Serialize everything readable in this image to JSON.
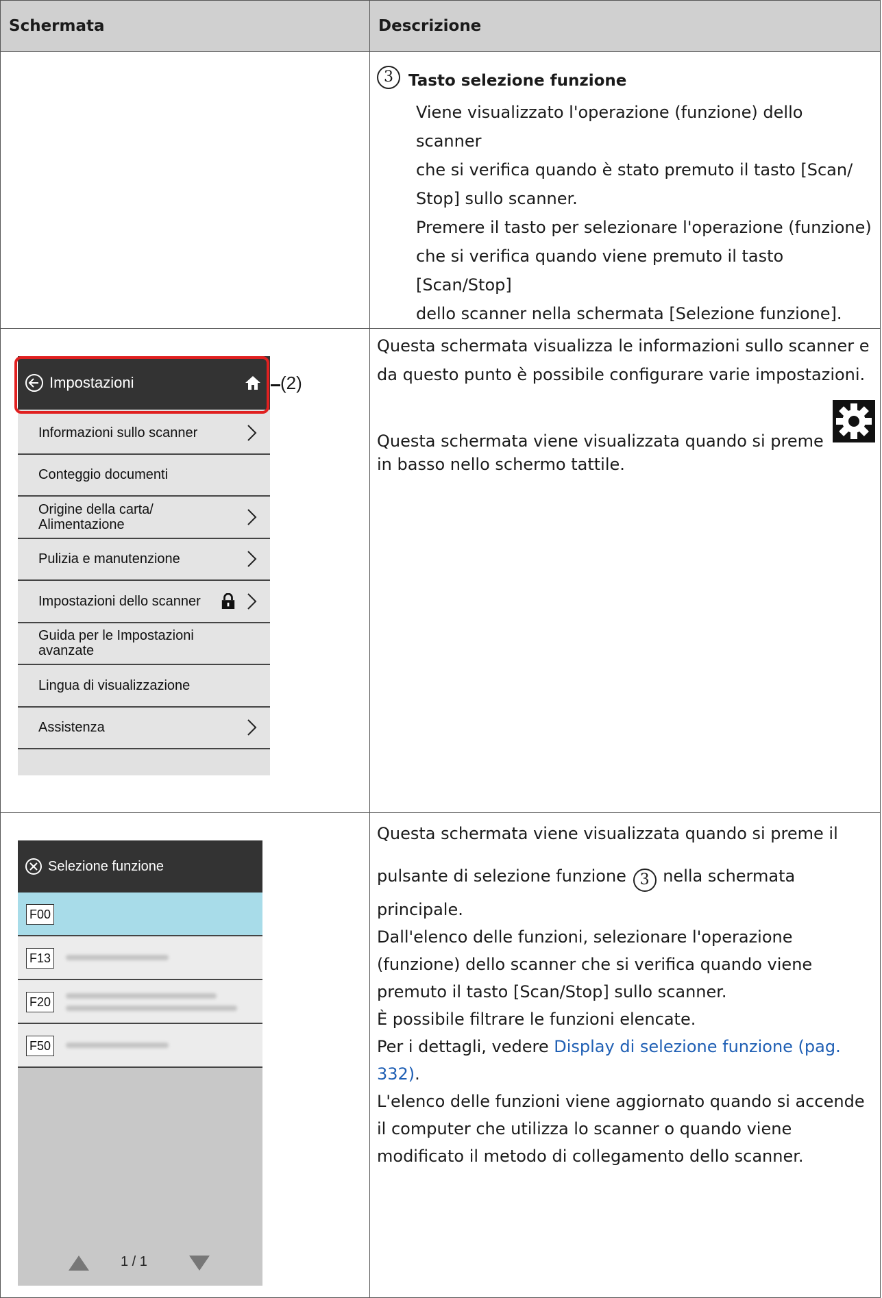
{
  "table": {
    "header_left": "Schermata",
    "header_right": "Descrizione"
  },
  "row1": {
    "circle_num": "3",
    "title": "Tasto selezione funzione",
    "lines": [
      "Viene visualizzato l'operazione (funzione) dello scanner",
      "che si verifica quando è stato premuto il tasto [Scan/",
      "Stop] sullo scanner.",
      "Premere il tasto per selezionare l'operazione (funzione)",
      "che si verifica quando viene premuto il tasto [Scan/Stop]",
      "dello scanner nella schermata [Selezione funzione]."
    ]
  },
  "row2": {
    "screen": {
      "back_icon": "circle-arrow-left-icon",
      "home_icon": "home-icon",
      "title": "Impostazioni",
      "callout": "(2)",
      "items": [
        {
          "label": "Informazioni sullo scanner",
          "chevron": true,
          "lock": false
        },
        {
          "label": "Conteggio documenti",
          "chevron": false,
          "lock": false
        },
        {
          "label": "Origine della carta/\nAlimentazione",
          "chevron": true,
          "lock": false
        },
        {
          "label": "Pulizia e manutenzione",
          "chevron": true,
          "lock": false
        },
        {
          "label": "Impostazioni dello scanner",
          "chevron": true,
          "lock": true
        },
        {
          "label": "Guida per le Impostazioni\navanzate",
          "chevron": false,
          "lock": false
        },
        {
          "label": "Lingua di visualizzazione",
          "chevron": false,
          "lock": false
        },
        {
          "label": "Assistenza",
          "chevron": true,
          "lock": false
        }
      ]
    },
    "desc_line1": "Questa schermata visualizza le informazioni sullo scanner e",
    "desc_line2": "da questo punto è possibile configurare varie impostazioni.",
    "desc_line3": "Questa schermata viene visualizzata quando si preme",
    "desc_line4": "in basso nello schermo tattile.",
    "gear_icon": "gear-icon"
  },
  "row3": {
    "screen": {
      "close_icon": "circle-x-icon",
      "title": "Selezione funzione",
      "functions": [
        "F00",
        "F13",
        "F20",
        "F50"
      ],
      "page_indicator": "1 / 1",
      "up_icon": "triangle-up-icon",
      "down_icon": "triangle-down-icon"
    },
    "circle_num": "3",
    "desc_line1": "Questa schermata viene visualizzata quando si preme il",
    "desc_line2a": "pulsante di selezione funzione",
    "desc_line2b": "nella schermata",
    "desc_line3": "principale.",
    "desc_line4": "Dall'elenco delle funzioni, selezionare l'operazione",
    "desc_line5": "(funzione) dello scanner che si verifica quando viene",
    "desc_line6": "premuto il tasto [Scan/Stop] sullo scanner.",
    "desc_line7": "È possibile filtrare le funzioni elencate.",
    "desc_line8_prefix": "Per i dettagli, vedere",
    "link_line1": "Display di selezione funzione (pag.",
    "link_line2": "332)",
    "link_suffix": ".",
    "desc_line10": "L'elenco delle funzioni viene aggiornato quando si accende",
    "desc_line11": "il computer che utilizza lo scanner o quando viene",
    "desc_line12": "modificato il metodo di collegamento dello scanner."
  },
  "colors": {
    "header_bg": "#d0d0d0",
    "screen_header": "#333333",
    "selected_row": "#a8dce9",
    "callout_red": "#e02020",
    "link": "#1f5fb4"
  }
}
